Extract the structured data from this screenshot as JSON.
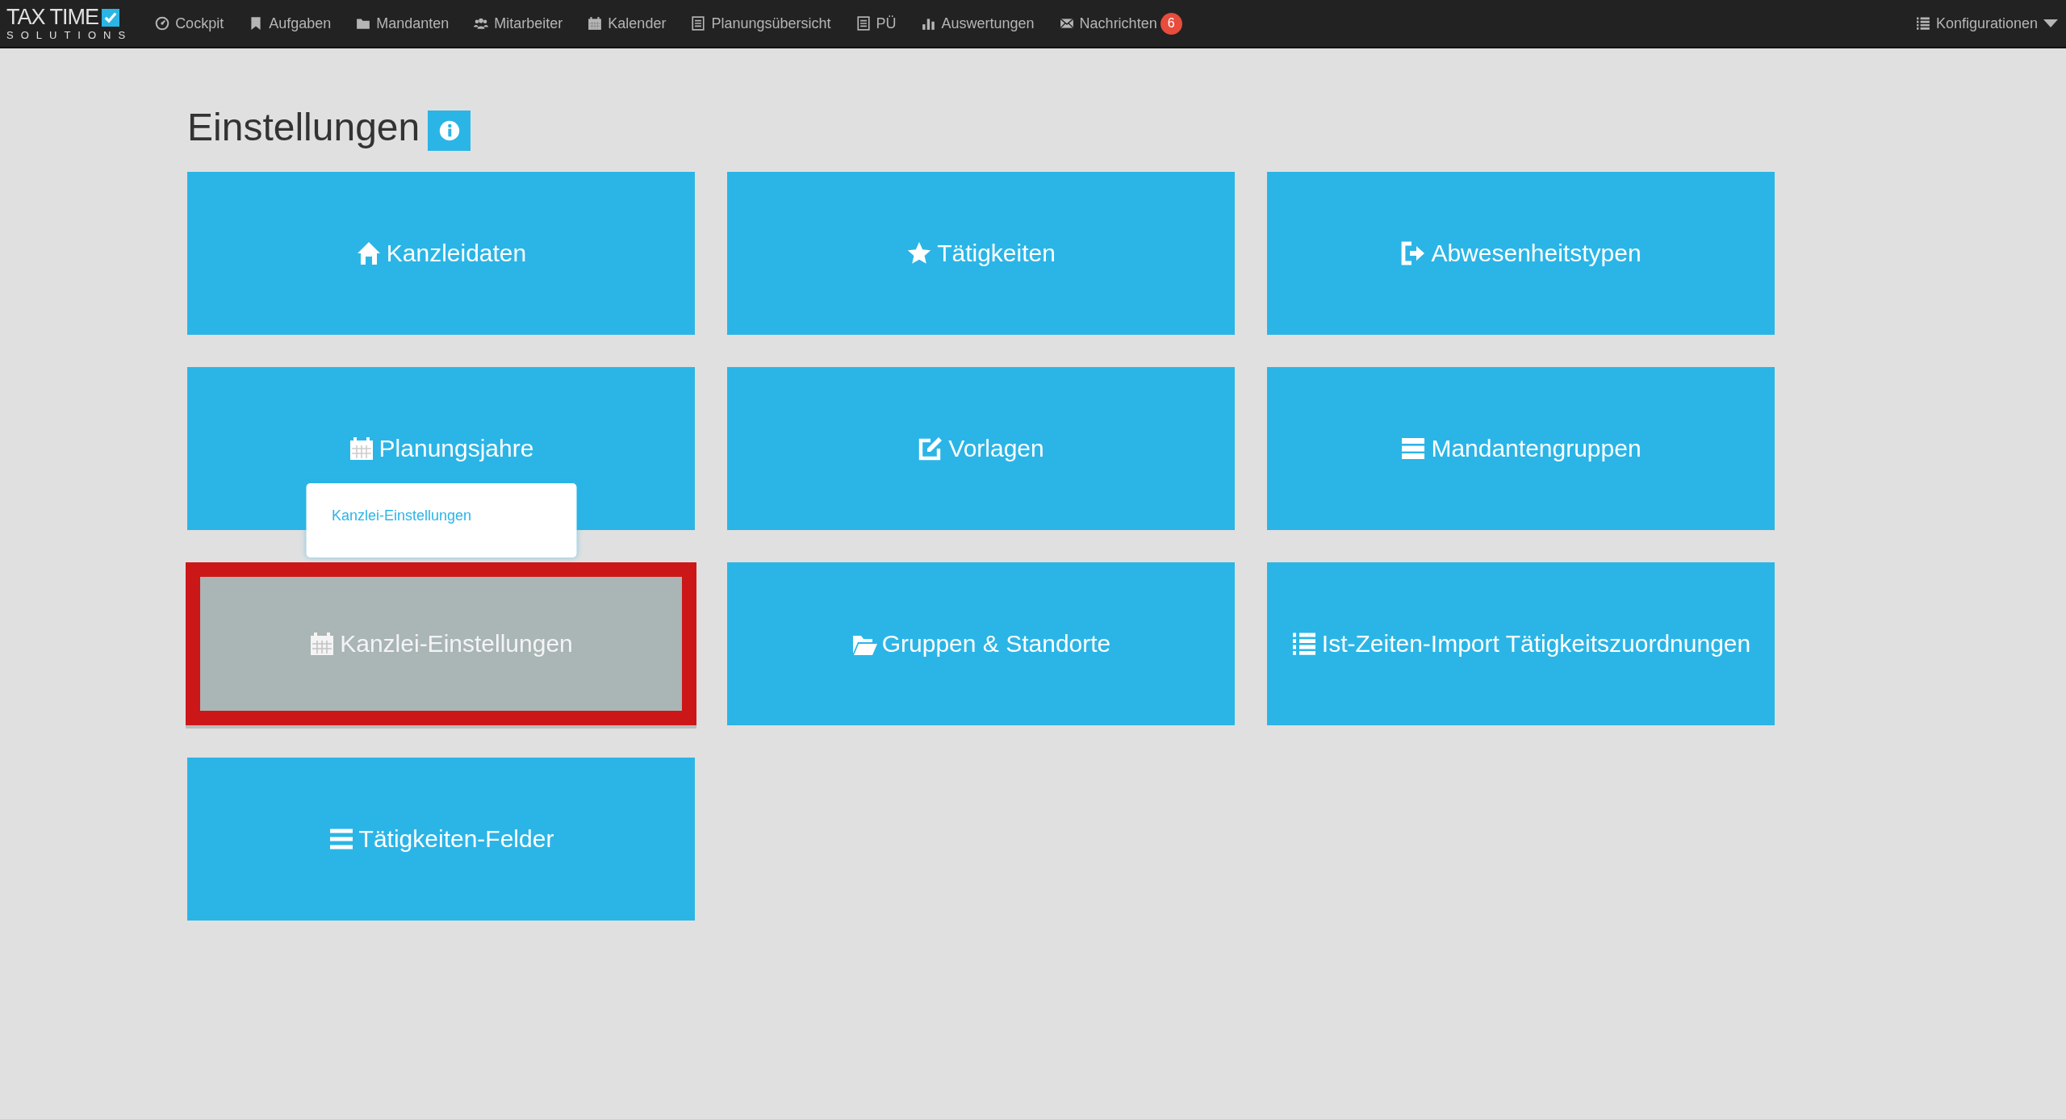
{
  "brand": {
    "title": "TAX TIME",
    "subtitle": "SOLUTIONS"
  },
  "nav": {
    "items": [
      {
        "label": "Cockpit"
      },
      {
        "label": "Aufgaben"
      },
      {
        "label": "Mandanten"
      },
      {
        "label": "Mitarbeiter"
      },
      {
        "label": "Kalender"
      },
      {
        "label": "Planungsübersicht"
      },
      {
        "label": "PÜ"
      },
      {
        "label": "Auswertungen"
      },
      {
        "label": "Nachrichten",
        "badge": "6"
      }
    ],
    "config": {
      "label": "Konfigurationen"
    }
  },
  "page": {
    "title": "Einstellungen"
  },
  "tiles": [
    {
      "label": "Kanzleidaten",
      "selected": false
    },
    {
      "label": "Tätigkeiten",
      "selected": false
    },
    {
      "label": "Abwesenheitstypen",
      "selected": false
    },
    {
      "label": "Planungsjahre",
      "selected": false
    },
    {
      "label": "Vorlagen",
      "selected": false
    },
    {
      "label": "Mandantengruppen",
      "selected": false
    },
    {
      "label": "Kanzlei-Einstellungen",
      "selected": true,
      "tooltip": "Kanzlei-Einstellungen"
    },
    {
      "label": "Gruppen & Standorte",
      "selected": false
    },
    {
      "label": "Ist-Zeiten-Import Tätigkeitszuordnungen",
      "selected": false
    },
    {
      "label": "Tätigkeiten-Felder",
      "selected": false
    }
  ]
}
